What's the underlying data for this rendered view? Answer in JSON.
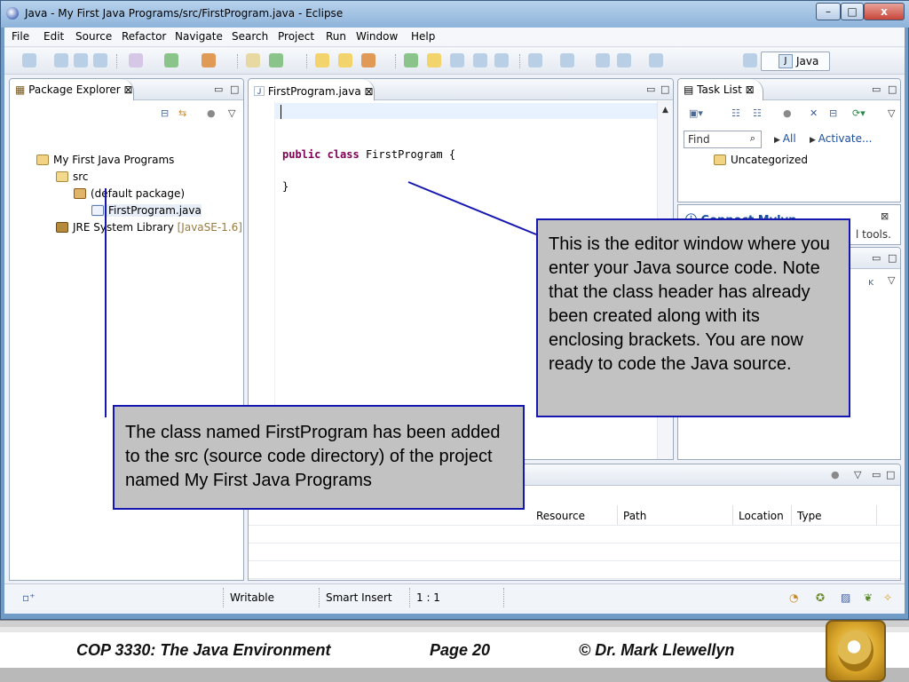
{
  "window": {
    "title": "Java - My First Java Programs/src/FirstProgram.java - Eclipse",
    "min_label": "–",
    "max_label": "□",
    "close_label": "x"
  },
  "menu": [
    "File",
    "Edit",
    "Source",
    "Refactor",
    "Navigate",
    "Search",
    "Project",
    "Run",
    "Window",
    "Help"
  ],
  "toolbar": {
    "perspective_label": "Java"
  },
  "package_explorer": {
    "tab_label": "Package Explorer",
    "tree": [
      {
        "label": "My First Java Programs",
        "icon": "project-icon"
      },
      {
        "label": "src",
        "icon": "source-folder-icon"
      },
      {
        "label": "(default package)",
        "icon": "package-icon"
      },
      {
        "label": "FirstProgram.java",
        "icon": "java-file-icon"
      },
      {
        "label": "JRE System Library",
        "suffix": "[JavaSE-1.6]",
        "icon": "library-icon"
      }
    ]
  },
  "editor": {
    "tab_label": "FirstProgram.java",
    "code_line1_kw1": "public",
    "code_line1_kw2": "class",
    "code_line1_rest": "FirstProgram {",
    "code_line2": "}"
  },
  "task_list": {
    "tab_label": "Task List",
    "find_placeholder": "Find",
    "all_label": "All",
    "activate_label": "Activate...",
    "uncategorized_label": "Uncategorized"
  },
  "mylyn": {
    "title": "Connect Mylyn",
    "text_tail": "l tools."
  },
  "problems": {
    "columns": [
      "Resource",
      "Path",
      "Location",
      "Type"
    ]
  },
  "status": {
    "writable": "Writable",
    "insert_mode": "Smart Insert",
    "position": "1 : 1"
  },
  "callouts": {
    "editor_note": "This is the editor window where you enter your Java source code.  Note that the class header has already been created along with its enclosing brackets.  You are now ready to code the Java source.",
    "class_note": "The class named FirstProgram has been added to the src (source code directory) of the project named My First Java Programs"
  },
  "footer": {
    "course": "COP 3330:  The Java Environment",
    "page": "Page 20",
    "author": "© Dr. Mark Llewellyn"
  }
}
